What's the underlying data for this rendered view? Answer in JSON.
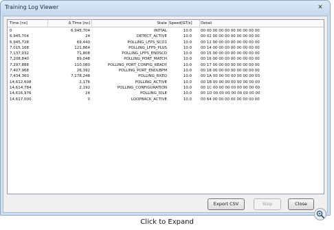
{
  "window": {
    "title": "Training Log Viewer",
    "close_glyph": "✕"
  },
  "table": {
    "columns": [
      "Time [ns]",
      "Δ Time [ns]",
      "State",
      "Speed[GT/s]",
      "Detail"
    ],
    "rows": [
      [
        "0",
        "6,945,704",
        "INITIAL",
        "10.0",
        "00 00 00 00 00 00 00 00 00 00"
      ],
      [
        "6,945,704",
        "24",
        "DETECT_ACTIVE",
        "10.0",
        "00 02 00 00 00 00 00 00 00 00"
      ],
      [
        "6,945,728",
        "69,440",
        "POLLING_LFPS_SCD1",
        "10.0",
        "00 12 00 00 00 00 00 00 00 00"
      ],
      [
        "7,015,168",
        "121,864",
        "POLLING_LFPS_PLUS",
        "10.0",
        "00 14 00 00 00 00 00 00 00 00"
      ],
      [
        "7,137,032",
        "71,808",
        "POLLING_LFPS_ENDSCD",
        "10.0",
        "00 15 00 00 00 00 00 00 00 00"
      ],
      [
        "7,208,840",
        "89,048",
        "POLLING_PORT_MATCH",
        "10.0",
        "00 16 00 00 00 00 00 00 00 00"
      ],
      [
        "7,297,888",
        "110,080",
        "POLLING_PORT_CONFIG_READY",
        "10.0",
        "00 17 00 00 00 00 00 00 00 00"
      ],
      [
        "7,407,968",
        "26,392",
        "POLLING_PORT_ENDLBPM",
        "10.0",
        "00 18 00 00 00 00 00 00 00 00"
      ],
      [
        "7,434,360",
        "7,178,248",
        "POLLING_RXEQ",
        "10.0",
        "00 1A 00 00 00 00 00 00 00 00"
      ],
      [
        "14,612,608",
        "2,176",
        "POLLING_ACTIVE",
        "10.0",
        "00 1B 00 00 00 00 00 00 00 00"
      ],
      [
        "14,614,784",
        "2,192",
        "POLLING_CONFIGURATION",
        "10.0",
        "00 1C 00 00 00 00 00 00 00 00"
      ],
      [
        "14,616,976",
        "24",
        "POLLING_IDLE",
        "10.0",
        "00 1D 00 00 00 00 00 00 00 00"
      ],
      [
        "14,617,000",
        "0",
        "LOOPBACK_ACTIVE",
        "10.0",
        "00 64 00 00 00 00 00 00 00 00"
      ]
    ]
  },
  "buttons": {
    "export": "Export CSV",
    "stop": "Stop",
    "close": "Close"
  },
  "caption": "Click to Expand",
  "icons": {
    "zoom": "magnifier-plus-icon"
  }
}
